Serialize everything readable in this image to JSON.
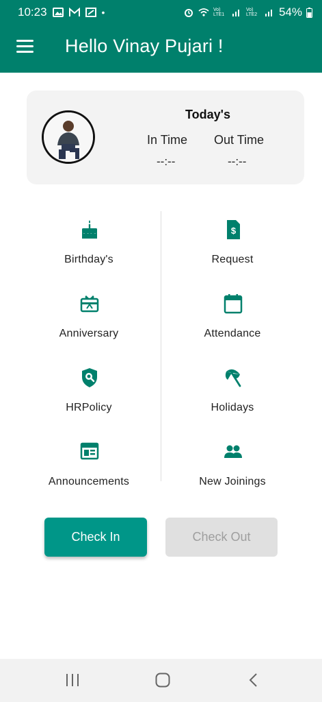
{
  "status_bar": {
    "time": "10:23",
    "left_icons": [
      "gallery-icon",
      "gmail-icon",
      "app-icon"
    ],
    "right_icons": [
      "alarm-icon",
      "wifi-icon",
      "volte1-signal-icon",
      "volte2-signal-icon",
      "battery-icon"
    ],
    "network1": "Vo) LTE1",
    "network2": "Vo) LTE2",
    "battery": "54%"
  },
  "app_bar": {
    "title": "Hello Vinay Pujari !",
    "menu_icon": "hamburger-menu-icon"
  },
  "attendance_card": {
    "heading": "Today's",
    "in_time_label": "In Time",
    "out_time_label": "Out Time",
    "in_time_value": "--:--",
    "out_time_value": "--:--"
  },
  "menu": {
    "left": [
      {
        "label": "Birthday's",
        "icon": "cake-icon"
      },
      {
        "label": "Anniversary",
        "icon": "gift-card-icon"
      },
      {
        "label": "HRPolicy",
        "icon": "shield-search-icon"
      },
      {
        "label": "Announcements",
        "icon": "newspaper-icon"
      }
    ],
    "right": [
      {
        "label": "Request",
        "icon": "dollar-document-icon"
      },
      {
        "label": "Attendance",
        "icon": "calendar-icon"
      },
      {
        "label": "Holidays",
        "icon": "beach-umbrella-icon"
      },
      {
        "label": "New Joinings",
        "icon": "people-icon"
      }
    ]
  },
  "buttons": {
    "check_in": "Check In",
    "check_out": "Check Out"
  },
  "colors": {
    "primary": "#00806c",
    "accent": "#009688",
    "disabled_bg": "#e0e0e0",
    "disabled_text": "#9e9e9e"
  },
  "nav_bar": {
    "icons": [
      "recent-apps-icon",
      "home-icon",
      "back-icon"
    ]
  }
}
